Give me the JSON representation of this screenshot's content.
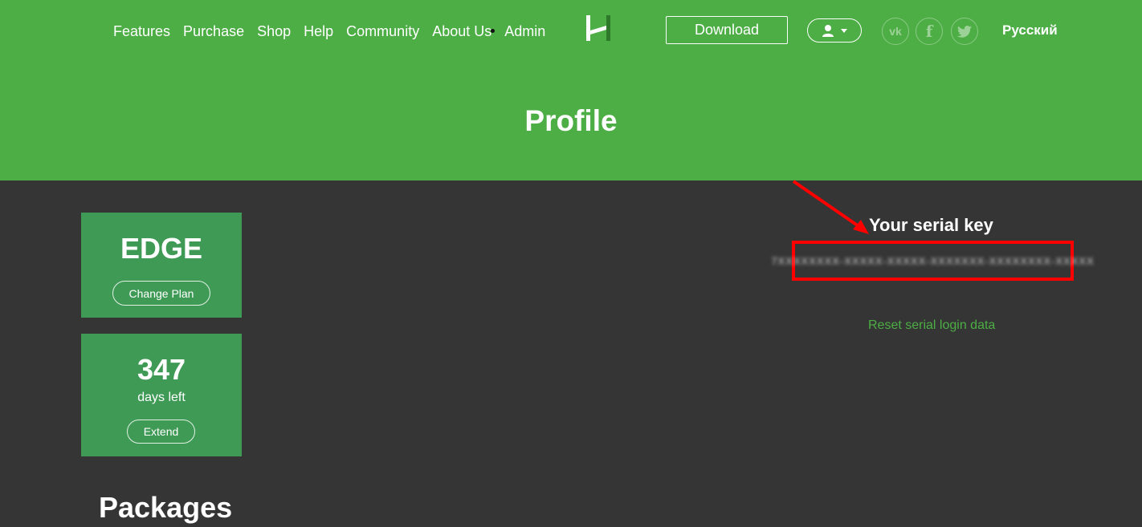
{
  "nav": {
    "items": [
      {
        "label": "Features"
      },
      {
        "label": "Purchase"
      },
      {
        "label": "Shop"
      },
      {
        "label": "Help"
      },
      {
        "label": "Community"
      },
      {
        "label": "About Us"
      },
      {
        "label": "Admin"
      }
    ]
  },
  "header": {
    "logo_icon": "logo-h-icon",
    "download_label": "Download",
    "user_icon": "user-icon",
    "social": [
      {
        "name": "vk",
        "glyph": "vk",
        "icon": "vk-icon"
      },
      {
        "name": "facebook",
        "glyph": "f",
        "icon": "facebook-icon"
      },
      {
        "name": "twitter",
        "icon": "twitter-icon"
      }
    ],
    "language": "Русский"
  },
  "page": {
    "title": "Profile"
  },
  "plan": {
    "name": "EDGE",
    "change_label": "Change Plan"
  },
  "subscription": {
    "days": "347",
    "days_label": "days left",
    "extend_label": "Extend"
  },
  "packages": {
    "title": "Packages"
  },
  "serial": {
    "title": "Your serial key",
    "value": "7XXXXXXXX-XXXXX-XXXXX-XXXXXXX-XXXXXXXX-XXXXX",
    "reset_label": "Reset serial login data"
  },
  "colors": {
    "header_green": "#4cae44",
    "card_green": "#3f9a56",
    "background": "#353535",
    "highlight_red": "#ff0000",
    "link_green": "#4cae44"
  }
}
